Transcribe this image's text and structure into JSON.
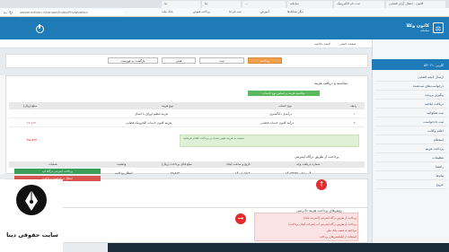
{
  "browser": {
    "tabs": [
      "قانون - انتقال آرای قضایی",
      "ثبت نام الکترونیک",
      "سامانه",
      "...",
      "ثنا",
      "ثنا"
    ],
    "url": "lawyer.adliran.ir/kanoon/Index/Privatization",
    "bookmarks": [
      "بانک ملت",
      "پرداخت قبوض",
      "ثبت نام ثنا",
      "آموزش",
      "دیگر نشانک‌ها"
    ]
  },
  "header": {
    "brand_title": "کانون وکلا",
    "brand_sub": "سامانه"
  },
  "breadcrumb": [
    "صفحه اصلی",
    "لایحه دفاعیه"
  ],
  "sidebar": {
    "user": "کاربر: ۵۴۰۶۱",
    "items": [
      "ارسال لایحه قضایی",
      "درخواست‌های ثبت‌شده",
      "پیگیری پرونده",
      "دریافت ابلاغیه",
      "ثبت شکوائیه",
      "ثبت دادخواست",
      "اعلام وکالت",
      "استعلام",
      "پرداخت هزینه",
      "تنظیمات",
      "راهنما",
      "پیام‌ها",
      "خروج"
    ]
  },
  "toolbar": {
    "btn_submit": "ثبت",
    "btn_prev": "قبلی",
    "btn_back": "بازگشت به فهرست",
    "btn_pay": "پرداخت"
  },
  "payment_panel": {
    "title": "محاسبه و دریافت هزینه",
    "tag": "محاسبه هزینه بر اساس نوع خدمات",
    "columns": [
      "ردیف",
      "نوع حساب",
      "نوع هزینه",
      "مبلغ (ریال)"
    ],
    "rows": [
      {
        "num": "۱",
        "account": "درآمدی دادگستری",
        "type": "هزینه تنظیم اوراق با اعمال",
        "amount": "۰"
      },
      {
        "num": "۲",
        "account": "درآمد کانون خدمات قضایی",
        "type": "هزینه کانون خدمات الکترونیک قضایی",
        "amount": "۲۸,۸۶۳"
      }
    ],
    "total_label": "جمع کل (ریال)",
    "total": "۲۸,۸۶۳",
    "note": "نسبت به هزینه تعیین شده در پرداخت اقدام فرمایید"
  },
  "online_panel": {
    "title": "پرداخت از طریق درگاه اینترنتی",
    "columns": [
      "شماره دریافت وجه",
      "تاریخ و ساعت ایجاد",
      "مبلغ قابل پرداخت (ریال)",
      "وضعیت",
      "عملیات"
    ],
    "row": {
      "receipt": "۱۴۰۳۳۲۷۲۰۰۸۱۰۰۰۴",
      "date": "۱۴۰۰/۰۹/۱۳",
      "amount": "۲۸,۸۶۳",
      "status": "انتظار پرداخت"
    },
    "btn_pay": "پرداخت اینترنتی درگاه آپ",
    "btn_cancel": "ابطال درخواست پرداخت"
  },
  "methods_panel": {
    "title": "روش‌های پرداخت هزینه دادرسی",
    "lines": [
      "پرداخت از طریق درگاه اینترنتی (اینترنت بانک)",
      "پرداخت از طریق درگاه اینترنتی آپ (شرکت آسان پرداخت)",
      "مراجعه به شعب بانک ملی",
      "استفاده از اپلیکیشن‌های پرداخت"
    ]
  },
  "watermark": "سایت حقوقی دینا",
  "colors": {
    "header": "#1f7ab8",
    "green": "#5cb85c",
    "red": "#d9534f",
    "orange": "#f0a04b"
  }
}
